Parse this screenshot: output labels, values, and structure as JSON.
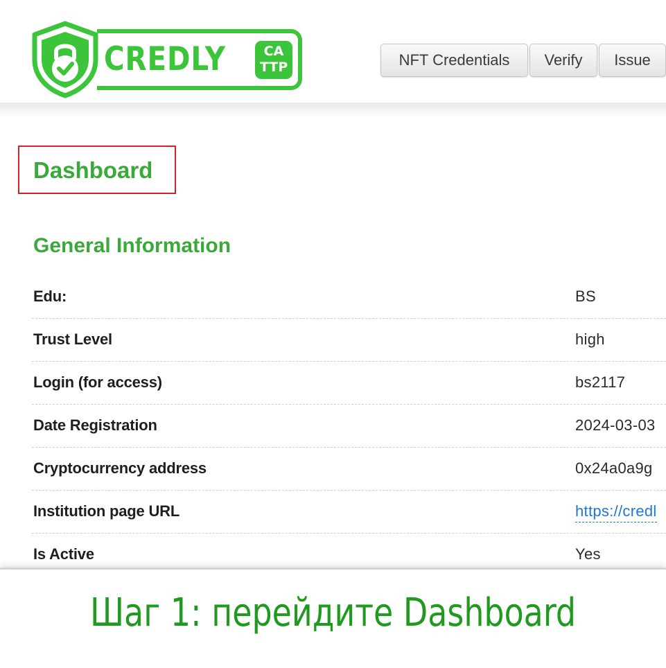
{
  "brand": {
    "logo_text": "CREDLY",
    "badge_line1": "CA",
    "badge_line2": "TTP",
    "accent_color": "#3cc43a",
    "shield_icon": "shield-check-icon"
  },
  "nav": {
    "items": [
      {
        "label": "NFT Credentials"
      },
      {
        "label": "Verify"
      },
      {
        "label": "Issue"
      }
    ]
  },
  "page": {
    "title": "Dashboard",
    "section_title": "General Information",
    "title_color": "#3aa93a",
    "highlight_color": "#c8262c"
  },
  "info": {
    "rows": [
      {
        "label": "Edu:",
        "value": "BS"
      },
      {
        "label": "Trust Level",
        "value": "high"
      },
      {
        "label": "Login (for access)",
        "value": "bs2117"
      },
      {
        "label": "Date Registration",
        "value": "2024-03-03"
      },
      {
        "label": "Cryptocurrency address",
        "value": "0x24a0a9g"
      },
      {
        "label": "Institution page URL",
        "value": "https://credl"
      },
      {
        "label": "Is Active",
        "value": "Yes"
      }
    ]
  },
  "caption": {
    "text": "Шаг 1: перейдите Dashboard",
    "color": "#1f9a1f"
  }
}
